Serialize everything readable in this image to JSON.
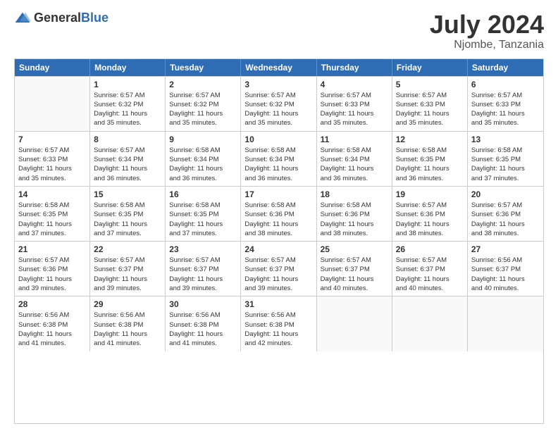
{
  "logo": {
    "general": "General",
    "blue": "Blue"
  },
  "title": "July 2024",
  "subtitle": "Njombe, Tanzania",
  "header_days": [
    "Sunday",
    "Monday",
    "Tuesday",
    "Wednesday",
    "Thursday",
    "Friday",
    "Saturday"
  ],
  "weeks": [
    [
      {
        "day": "",
        "info": ""
      },
      {
        "day": "1",
        "info": "Sunrise: 6:57 AM\nSunset: 6:32 PM\nDaylight: 11 hours\nand 35 minutes."
      },
      {
        "day": "2",
        "info": "Sunrise: 6:57 AM\nSunset: 6:32 PM\nDaylight: 11 hours\nand 35 minutes."
      },
      {
        "day": "3",
        "info": "Sunrise: 6:57 AM\nSunset: 6:32 PM\nDaylight: 11 hours\nand 35 minutes."
      },
      {
        "day": "4",
        "info": "Sunrise: 6:57 AM\nSunset: 6:33 PM\nDaylight: 11 hours\nand 35 minutes."
      },
      {
        "day": "5",
        "info": "Sunrise: 6:57 AM\nSunset: 6:33 PM\nDaylight: 11 hours\nand 35 minutes."
      },
      {
        "day": "6",
        "info": "Sunrise: 6:57 AM\nSunset: 6:33 PM\nDaylight: 11 hours\nand 35 minutes."
      }
    ],
    [
      {
        "day": "7",
        "info": "Sunrise: 6:57 AM\nSunset: 6:33 PM\nDaylight: 11 hours\nand 35 minutes."
      },
      {
        "day": "8",
        "info": "Sunrise: 6:57 AM\nSunset: 6:34 PM\nDaylight: 11 hours\nand 36 minutes."
      },
      {
        "day": "9",
        "info": "Sunrise: 6:58 AM\nSunset: 6:34 PM\nDaylight: 11 hours\nand 36 minutes."
      },
      {
        "day": "10",
        "info": "Sunrise: 6:58 AM\nSunset: 6:34 PM\nDaylight: 11 hours\nand 36 minutes."
      },
      {
        "day": "11",
        "info": "Sunrise: 6:58 AM\nSunset: 6:34 PM\nDaylight: 11 hours\nand 36 minutes."
      },
      {
        "day": "12",
        "info": "Sunrise: 6:58 AM\nSunset: 6:35 PM\nDaylight: 11 hours\nand 36 minutes."
      },
      {
        "day": "13",
        "info": "Sunrise: 6:58 AM\nSunset: 6:35 PM\nDaylight: 11 hours\nand 37 minutes."
      }
    ],
    [
      {
        "day": "14",
        "info": "Sunrise: 6:58 AM\nSunset: 6:35 PM\nDaylight: 11 hours\nand 37 minutes."
      },
      {
        "day": "15",
        "info": "Sunrise: 6:58 AM\nSunset: 6:35 PM\nDaylight: 11 hours\nand 37 minutes."
      },
      {
        "day": "16",
        "info": "Sunrise: 6:58 AM\nSunset: 6:35 PM\nDaylight: 11 hours\nand 37 minutes."
      },
      {
        "day": "17",
        "info": "Sunrise: 6:58 AM\nSunset: 6:36 PM\nDaylight: 11 hours\nand 38 minutes."
      },
      {
        "day": "18",
        "info": "Sunrise: 6:58 AM\nSunset: 6:36 PM\nDaylight: 11 hours\nand 38 minutes."
      },
      {
        "day": "19",
        "info": "Sunrise: 6:57 AM\nSunset: 6:36 PM\nDaylight: 11 hours\nand 38 minutes."
      },
      {
        "day": "20",
        "info": "Sunrise: 6:57 AM\nSunset: 6:36 PM\nDaylight: 11 hours\nand 38 minutes."
      }
    ],
    [
      {
        "day": "21",
        "info": "Sunrise: 6:57 AM\nSunset: 6:36 PM\nDaylight: 11 hours\nand 39 minutes."
      },
      {
        "day": "22",
        "info": "Sunrise: 6:57 AM\nSunset: 6:37 PM\nDaylight: 11 hours\nand 39 minutes."
      },
      {
        "day": "23",
        "info": "Sunrise: 6:57 AM\nSunset: 6:37 PM\nDaylight: 11 hours\nand 39 minutes."
      },
      {
        "day": "24",
        "info": "Sunrise: 6:57 AM\nSunset: 6:37 PM\nDaylight: 11 hours\nand 39 minutes."
      },
      {
        "day": "25",
        "info": "Sunrise: 6:57 AM\nSunset: 6:37 PM\nDaylight: 11 hours\nand 40 minutes."
      },
      {
        "day": "26",
        "info": "Sunrise: 6:57 AM\nSunset: 6:37 PM\nDaylight: 11 hours\nand 40 minutes."
      },
      {
        "day": "27",
        "info": "Sunrise: 6:56 AM\nSunset: 6:37 PM\nDaylight: 11 hours\nand 40 minutes."
      }
    ],
    [
      {
        "day": "28",
        "info": "Sunrise: 6:56 AM\nSunset: 6:38 PM\nDaylight: 11 hours\nand 41 minutes."
      },
      {
        "day": "29",
        "info": "Sunrise: 6:56 AM\nSunset: 6:38 PM\nDaylight: 11 hours\nand 41 minutes."
      },
      {
        "day": "30",
        "info": "Sunrise: 6:56 AM\nSunset: 6:38 PM\nDaylight: 11 hours\nand 41 minutes."
      },
      {
        "day": "31",
        "info": "Sunrise: 6:56 AM\nSunset: 6:38 PM\nDaylight: 11 hours\nand 42 minutes."
      },
      {
        "day": "",
        "info": ""
      },
      {
        "day": "",
        "info": ""
      },
      {
        "day": "",
        "info": ""
      }
    ]
  ]
}
